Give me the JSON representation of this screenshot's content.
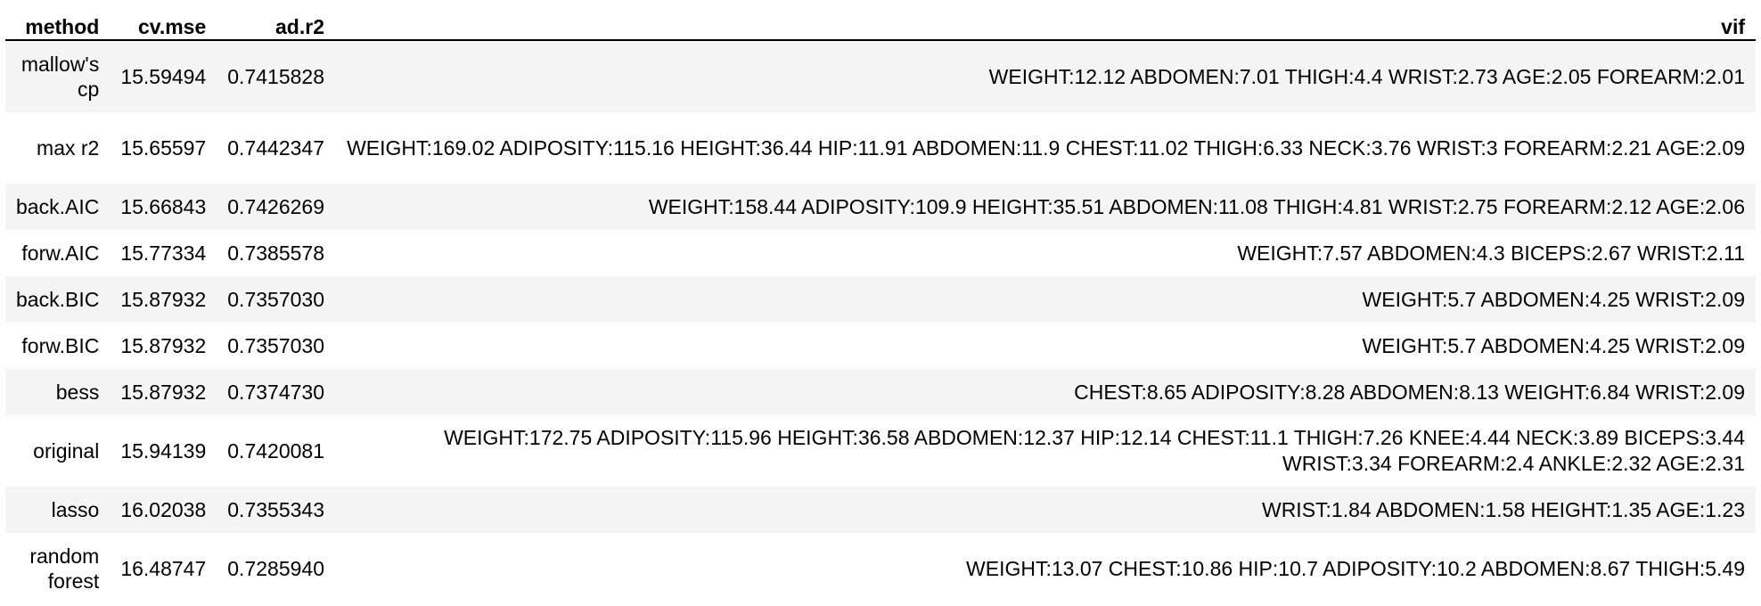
{
  "table": {
    "headers": {
      "method": "method",
      "cv_mse": "cv.mse",
      "ad_r2": "ad.r2",
      "vif": "vif"
    },
    "rows": [
      {
        "method": "mallow's cp",
        "cv_mse": "15.59494",
        "ad_r2": "0.7415828",
        "vif": "WEIGHT:12.12 ABDOMEN:7.01 THIGH:4.4 WRIST:2.73 AGE:2.05 FOREARM:2.01"
      },
      {
        "method": "max r2",
        "cv_mse": "15.65597",
        "ad_r2": "0.7442347",
        "vif": "WEIGHT:169.02 ADIPOSITY:115.16 HEIGHT:36.44 HIP:11.91 ABDOMEN:11.9 CHEST:11.02 THIGH:6.33 NECK:3.76 WRIST:3 FOREARM:2.21 AGE:2.09"
      },
      {
        "method": "back.AIC",
        "cv_mse": "15.66843",
        "ad_r2": "0.7426269",
        "vif": "WEIGHT:158.44 ADIPOSITY:109.9 HEIGHT:35.51 ABDOMEN:11.08 THIGH:4.81 WRIST:2.75 FOREARM:2.12 AGE:2.06"
      },
      {
        "method": "forw.AIC",
        "cv_mse": "15.77334",
        "ad_r2": "0.7385578",
        "vif": "WEIGHT:7.57 ABDOMEN:4.3 BICEPS:2.67 WRIST:2.11"
      },
      {
        "method": "back.BIC",
        "cv_mse": "15.87932",
        "ad_r2": "0.7357030",
        "vif": "WEIGHT:5.7 ABDOMEN:4.25 WRIST:2.09"
      },
      {
        "method": "forw.BIC",
        "cv_mse": "15.87932",
        "ad_r2": "0.7357030",
        "vif": "WEIGHT:5.7 ABDOMEN:4.25 WRIST:2.09"
      },
      {
        "method": "bess",
        "cv_mse": "15.87932",
        "ad_r2": "0.7374730",
        "vif": "CHEST:8.65 ADIPOSITY:8.28 ABDOMEN:8.13 WEIGHT:6.84 WRIST:2.09"
      },
      {
        "method": "original",
        "cv_mse": "15.94139",
        "ad_r2": "0.7420081",
        "vif": "WEIGHT:172.75 ADIPOSITY:115.96 HEIGHT:36.58 ABDOMEN:12.37 HIP:12.14 CHEST:11.1 THIGH:7.26 KNEE:4.44 NECK:3.89 BICEPS:3.44 WRIST:3.34 FOREARM:2.4 ANKLE:2.32 AGE:2.31"
      },
      {
        "method": "lasso",
        "cv_mse": "16.02038",
        "ad_r2": "0.7355343",
        "vif": "WRIST:1.84 ABDOMEN:1.58 HEIGHT:1.35 AGE:1.23"
      },
      {
        "method": "random forest",
        "cv_mse": "16.48747",
        "ad_r2": "0.7285940",
        "vif": "WEIGHT:13.07 CHEST:10.86 HIP:10.7 ADIPOSITY:10.2 ABDOMEN:8.67 THIGH:5.49"
      }
    ]
  },
  "colors": {
    "stripe": "#f5f5f5",
    "header_rule": "#000000",
    "text": "#000000"
  }
}
